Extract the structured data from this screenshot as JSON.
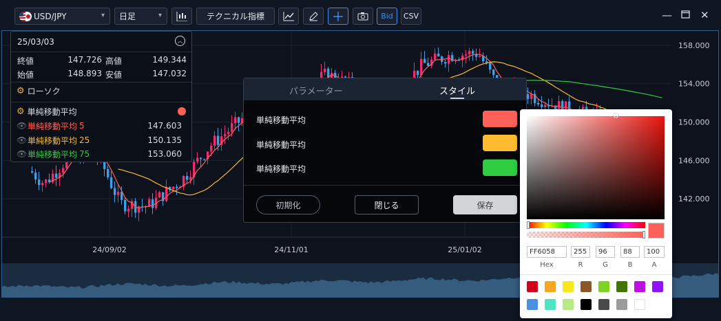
{
  "toolbar": {
    "symbol": "USD/JPY",
    "timeframe": "日足",
    "technical_label": "テクニカル指標",
    "bid_label": "Bid",
    "csv_label": "CSV"
  },
  "info": {
    "date": "25/03/03",
    "close_label": "終値",
    "close": "147.726",
    "high_label": "高値",
    "high": "149.344",
    "open_label": "始値",
    "open": "148.893",
    "low_label": "安値",
    "low": "147.032",
    "candle_label": "ローソク",
    "sma_label": "単純移動平均",
    "ma": [
      {
        "label": "単純移動平均",
        "period": "5",
        "value": "147.603",
        "color": "#ff6058"
      },
      {
        "label": "単純移動平均",
        "period": "25",
        "value": "150.135",
        "color": "#fdbb30"
      },
      {
        "label": "単純移動平均",
        "period": "75",
        "value": "153.060",
        "color": "#2ecc40"
      }
    ]
  },
  "dialog": {
    "tab_params": "パラメーター",
    "tab_style": "スタイル",
    "rows": [
      {
        "label": "単純移動平均",
        "color": "#ff6058"
      },
      {
        "label": "単純移動平均",
        "color": "#fdbb30"
      },
      {
        "label": "単純移動平均",
        "color": "#2ecc40"
      }
    ],
    "reset": "初期化",
    "close": "閉じる",
    "save": "保存"
  },
  "picker": {
    "hex": "FF6058",
    "r": "255",
    "g": "96",
    "b": "88",
    "a": "100",
    "hex_label": "Hex",
    "r_label": "R",
    "g_label": "G",
    "b_label": "B",
    "a_label": "A",
    "presets": [
      "#d0021b",
      "#f5a623",
      "#f8e71c",
      "#8b572a",
      "#7ed321",
      "#417505",
      "#bd10e0",
      "#9013fe",
      "#4a90e2",
      "#50e3c2",
      "#b8e986",
      "#000000",
      "#4a4a4a",
      "#9b9b9b",
      "#ffffff"
    ]
  },
  "chart_data": {
    "type": "line",
    "series": [
      {
        "name": "単純移動平均 5"
      },
      {
        "name": "単純移動平均 25"
      },
      {
        "name": "単純移動平均 75"
      }
    ],
    "x_ticks": [
      "24/09/02",
      "24/11/01",
      "25/01/02"
    ],
    "y_ticks": [
      "158.000",
      "154.000",
      "150.000",
      "146.000",
      "142.000"
    ],
    "ylim": [
      138.0,
      159.5
    ]
  }
}
